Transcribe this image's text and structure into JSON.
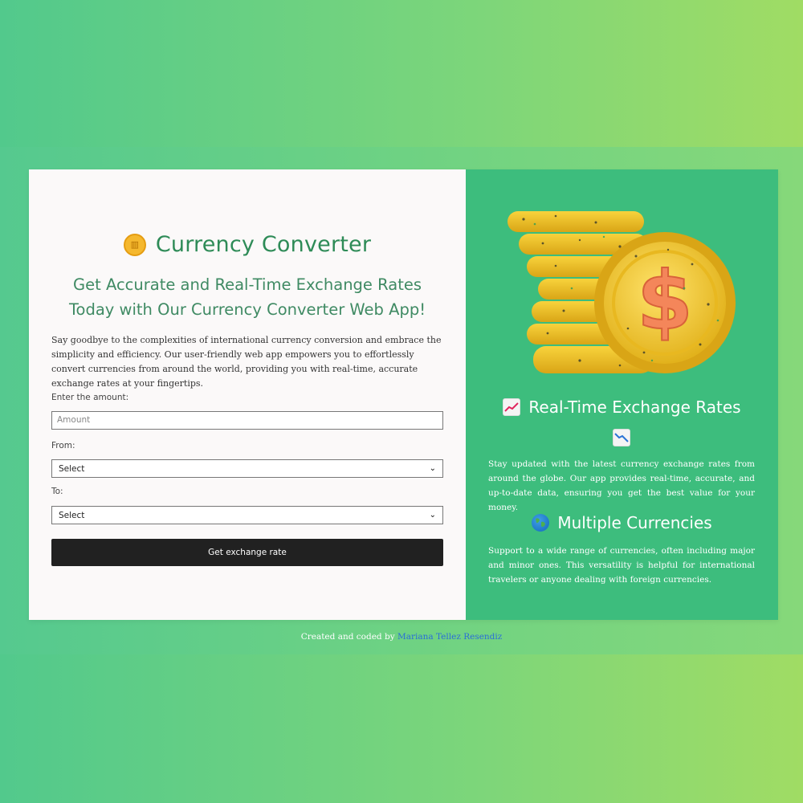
{
  "app": {
    "title": "Currency Converter",
    "title_icon": "coin-icon",
    "subtitle": "Get Accurate and Real-Time Exchange Rates Today with Our Currency Converter Web App!",
    "intro": "Say goodbye to the complexities of international currency conversion and embrace the simplicity and efficiency. Our user-friendly web app empowers you to effortlessly convert currencies from around the world, providing you with real-time, accurate exchange rates at your fingertips."
  },
  "form": {
    "amount_label": "Enter the amount:",
    "amount_placeholder": "Amount",
    "from_label": "From:",
    "from_value": "Select",
    "to_label": "To:",
    "to_value": "Select",
    "button_label": "Get exchange rate"
  },
  "features": [
    {
      "title": "Real-Time Exchange Rates",
      "icon": "chart-increasing-icon",
      "extra_icon": "chart-decreasing-icon",
      "text": "Stay updated with the latest currency exchange rates from around the globe. Our app provides real-time, accurate, and up-to-date data, ensuring you get the best value for your money."
    },
    {
      "title": "Multiple Currencies",
      "icon": "globe-icon",
      "text": "Support to a wide range of currencies, often including major and minor ones. This versatility is helpful for international travelers or anyone dealing with foreign currencies."
    }
  ],
  "footer": {
    "prefix": "Created and coded by",
    "author": "Mariana Tellez Resendiz"
  },
  "colors": {
    "accent": "#3dbd7d",
    "title": "#2e8b57",
    "button": "#212121",
    "link": "#2a6dd8"
  }
}
